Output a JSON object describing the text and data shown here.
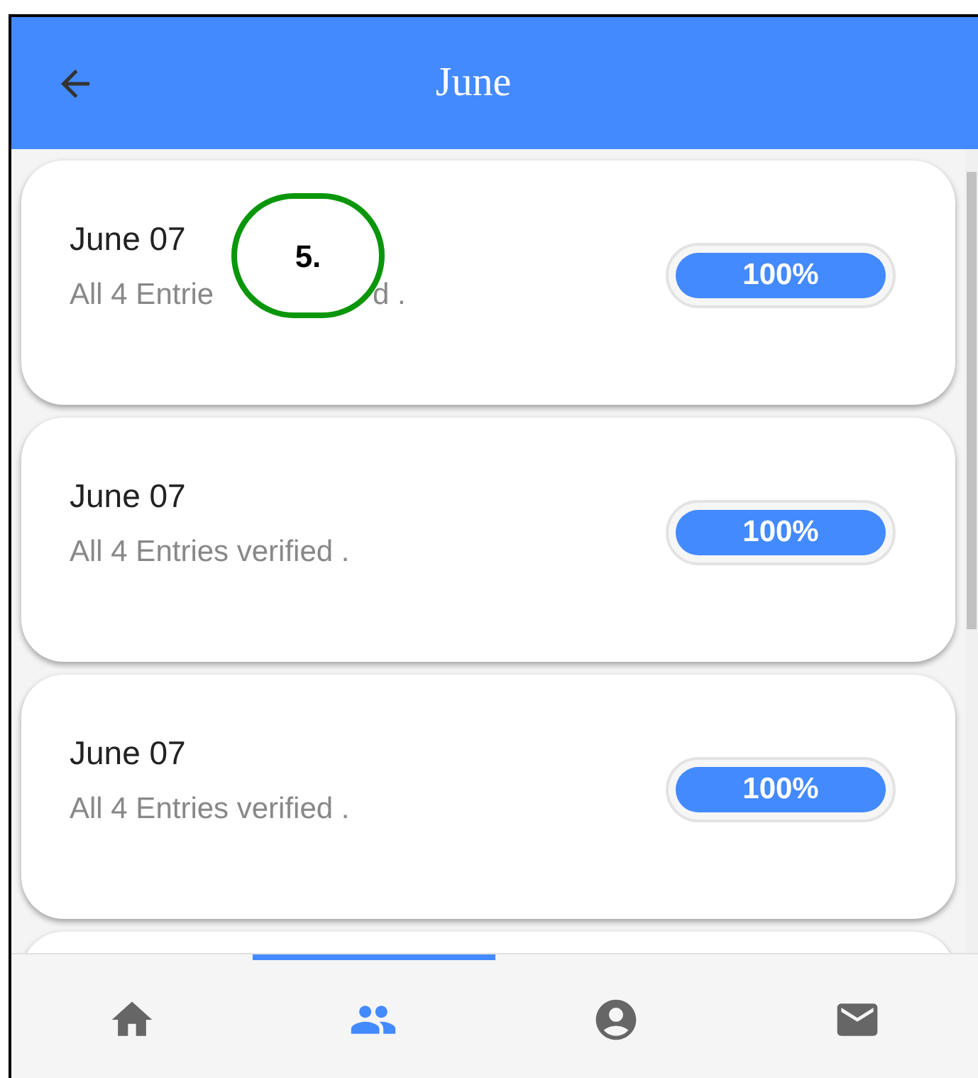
{
  "header": {
    "title": "June"
  },
  "cards": [
    {
      "title": "June 07",
      "subtitle": "All 4 Entrie",
      "subtitle_end": "d .",
      "level": 1,
      "reading": "100%"
    },
    {
      "title": "June 07",
      "subtitle": "All 4 Entries verified .",
      "level": 1,
      "reading": "100%"
    },
    {
      "title": "June 07",
      "subtitle": "All 4 Entries verified .",
      "level": 1,
      "reading": "100%"
    }
  ],
  "annotation": {
    "label": "5."
  },
  "bottom_nav": [
    {
      "kind": "home",
      "selected": false
    },
    {
      "kind": "people",
      "selected": true
    },
    {
      "kind": "account",
      "selected": false
    },
    {
      "kind": "mail",
      "selected": false
    }
  ]
}
